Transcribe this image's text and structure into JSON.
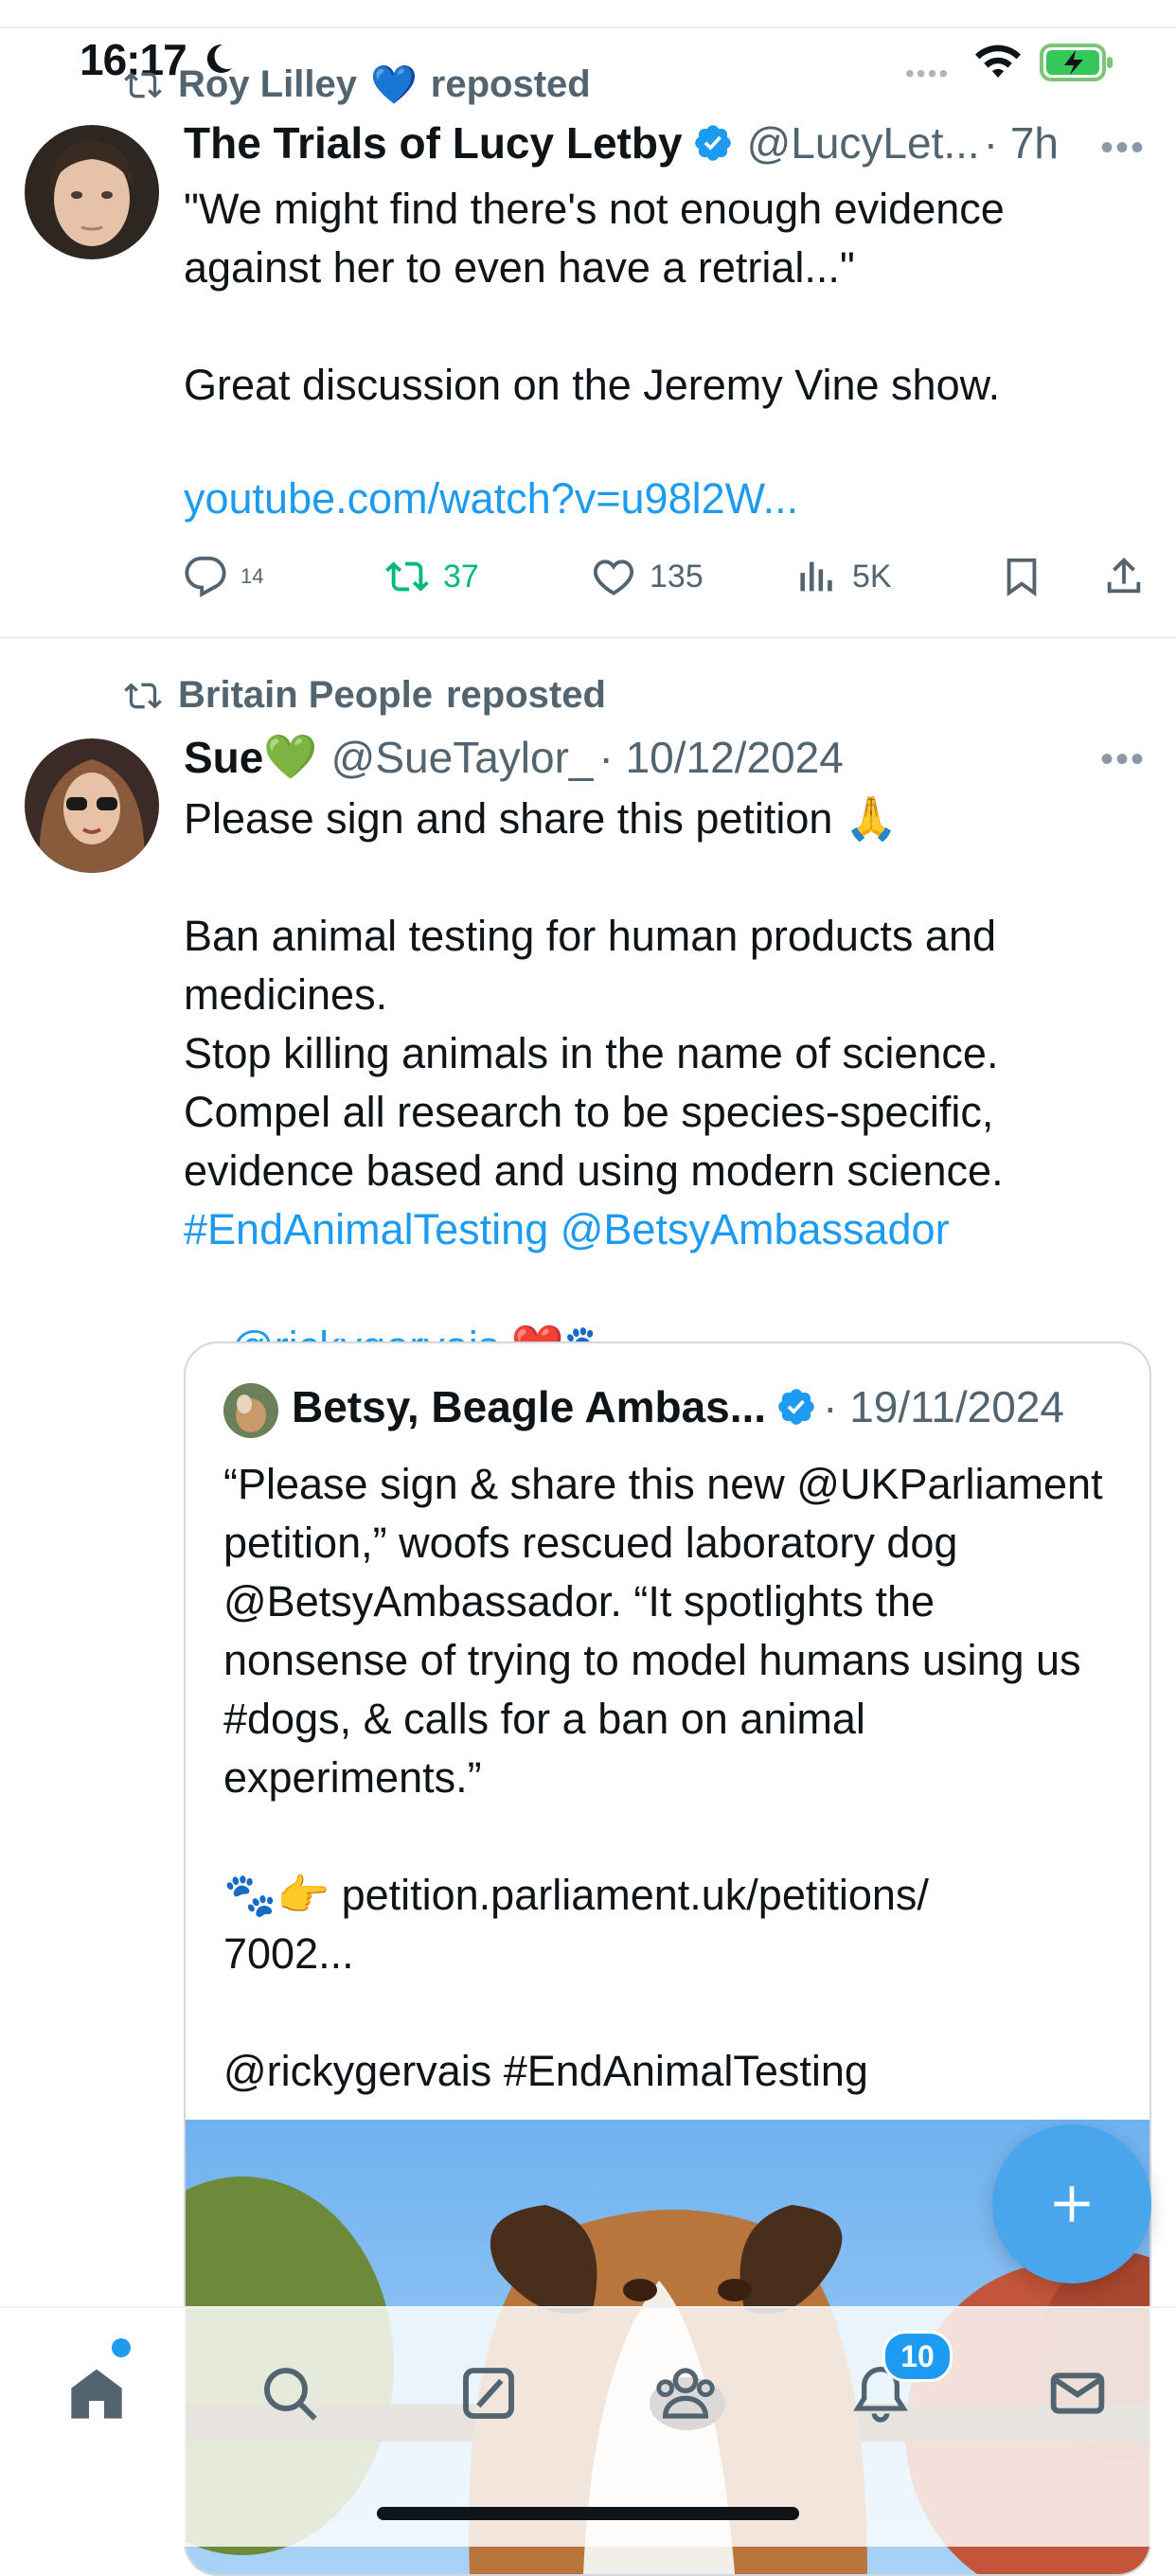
{
  "status_bar": {
    "time": "16:17",
    "dots": "••••"
  },
  "tweets": [
    {
      "reposted_by": "Roy Lilley",
      "reposted_by_emoji": "💙",
      "reposted_label": "reposted",
      "author_name": "The Trials of Lucy Letby",
      "handle": "@LucyLet...",
      "time": "· 7h",
      "text": "\"We might find there's not enough evidence against her to even have a retrial...\"\n\nGreat discussion on the Jeremy Vine show.\n",
      "link": "youtube.com/watch?v=u98l2W...",
      "actions": {
        "replies": "14",
        "reposts": "37",
        "likes": "135",
        "views": "5K"
      }
    },
    {
      "reposted_by": "Britain People",
      "reposted_label": "reposted",
      "author_name": "Sue",
      "author_emoji": "💚",
      "handle": "@SueTaylor_",
      "time": "· 10/12/2024",
      "text": "Please sign and share this petition 🙏\n\nBan animal testing for human products and medicines.\nStop killing animals in the name of science.\nCompel all research to be species-specific, evidence based and using modern science.",
      "hashtag_line": "#EndAnimalTesting @BetsyAmbassador",
      "mention_line": "@rickygervais",
      "mention_tail": " ❤️🐾",
      "quote": {
        "author_name": "Betsy, Beagle Ambas...",
        "time": "· 19/11/2024",
        "text": "“Please sign & share this new @UKParliament petition,” woofs rescued laboratory dog @BetsyAmbassador. “It spotlights the nonsense of trying to model humans using us #dogs, & calls for a ban on animal experiments.”\n\n🐾👉 petition.parliament.uk/petitions/\n7002...\n\n@rickygervais #EndAnimalTesting"
      }
    }
  ],
  "nav": {
    "notifications_badge": "10"
  },
  "colors": {
    "accent": "#1d9bf0",
    "repost_green": "#00ba7c",
    "secondary_text": "#536471"
  }
}
